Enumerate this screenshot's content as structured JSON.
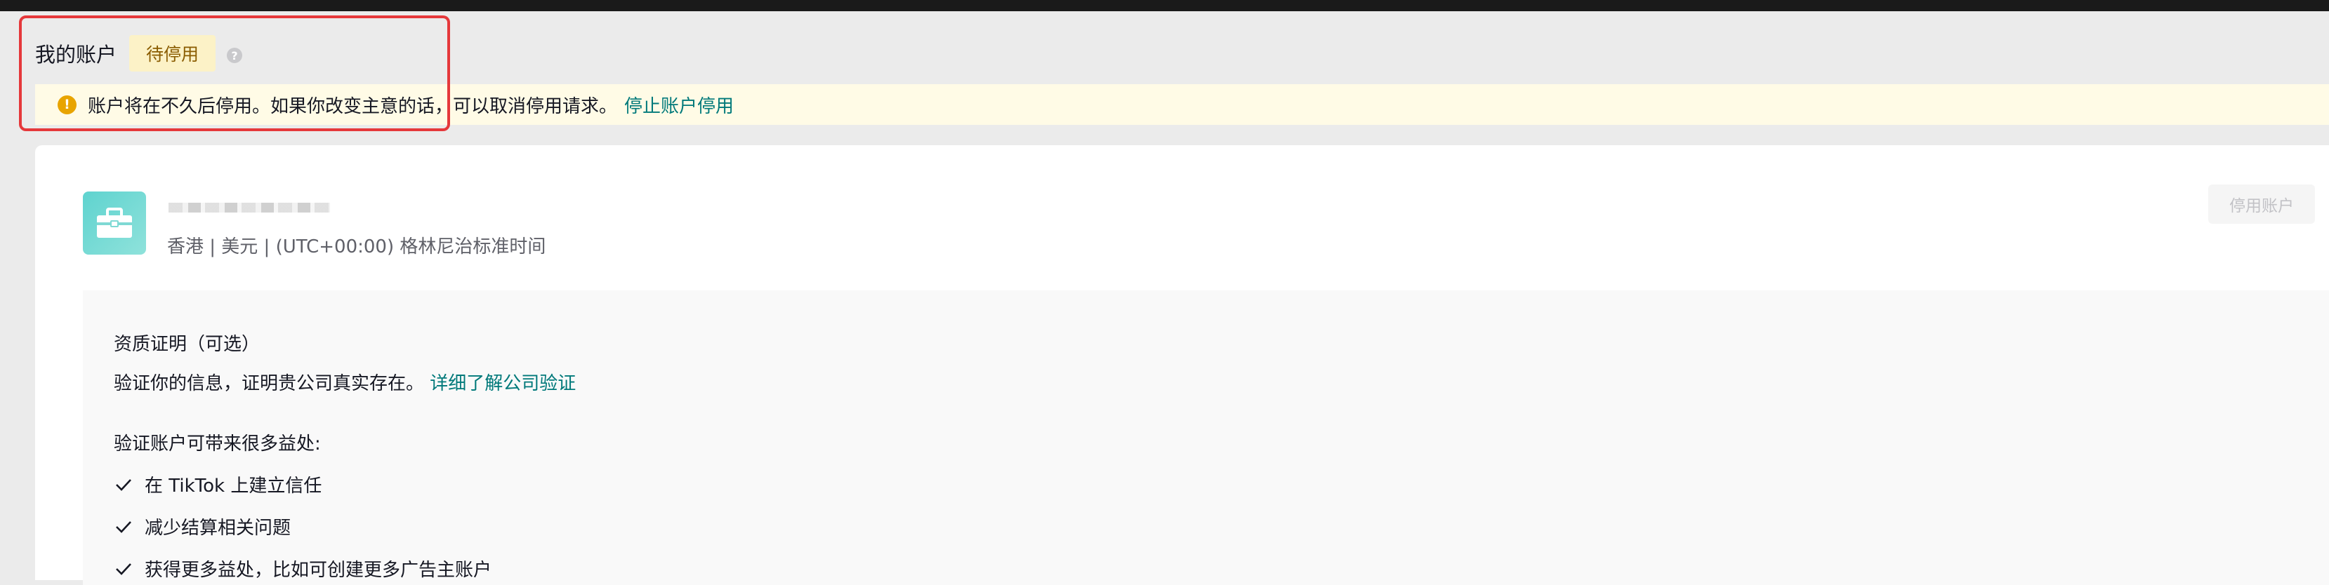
{
  "header": {
    "title": "我的账户",
    "status_badge": "待停用",
    "help_icon": "question-circle-icon"
  },
  "notice": {
    "icon": "exclamation-circle-icon",
    "text": "账户将在不久后停用。如果你改变主意的话，可以取消停用请求。",
    "link": "停止账户停用"
  },
  "account": {
    "avatar_icon": "briefcase-icon",
    "meta": "香港 | 美元 | (UTC+00:00) 格林尼治标准时间",
    "deactivate_button": "停用账户"
  },
  "verification": {
    "title": "资质证明（可选）",
    "description": "验证你的信息，证明贵公司真实存在。",
    "learn_more_link": "详细了解公司验证",
    "benefits_heading": "验证账户可带来很多益处:",
    "benefits": [
      "在 TikTok 上建立信任",
      "减少结算相关问题",
      "获得更多益处，比如可创建更多广告主账户"
    ]
  },
  "colors": {
    "accent_link": "#00797a",
    "highlight_border": "#e5383b",
    "badge_bg": "#fcf2c7",
    "notice_bg": "#fffbe6"
  }
}
